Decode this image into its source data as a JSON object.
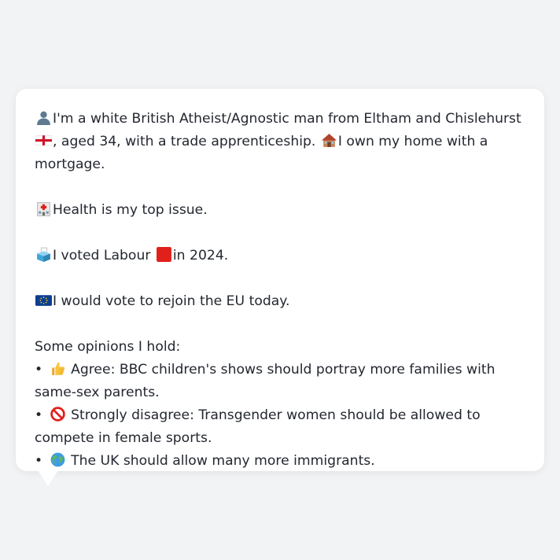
{
  "persona": {
    "intro_part1": "I'm a white British Atheist/Agnostic man from Eltham and Chislehurst",
    "intro_part2": ", aged 34, with a trade apprenticeship.",
    "intro_part3": "I own my home with a mortgage.",
    "health": "Health is my top issue.",
    "vote_part1": "I voted Labour",
    "vote_part2": "in 2024.",
    "eu": "I would vote to rejoin the EU today.",
    "opinions_heading": "Some opinions I hold:",
    "opinions": [
      {
        "bullet": "•",
        "text": "Agree: BBC children's shows should portray more families with same-sex parents.",
        "icon": "thumbs-up-icon"
      },
      {
        "bullet": "•",
        "text": "Strongly disagree: Transgender women should be allowed to compete in female sports.",
        "icon": "prohibited-icon"
      },
      {
        "bullet": "•",
        "text": "The UK should allow many more immigrants.",
        "icon": "globe-icon"
      }
    ]
  },
  "icons": {
    "person": "person-silhouette-icon",
    "england_flag": "england-flag-icon",
    "house": "house-icon",
    "hospital": "hospital-icon",
    "ballot_box": "ballot-box-icon",
    "labour_square": "red-square-icon",
    "eu_flag": "eu-flag-icon"
  },
  "colors": {
    "background": "#f1f3f5",
    "bubble": "#ffffff",
    "text": "#23272f",
    "labour_red": "#e0201b"
  }
}
